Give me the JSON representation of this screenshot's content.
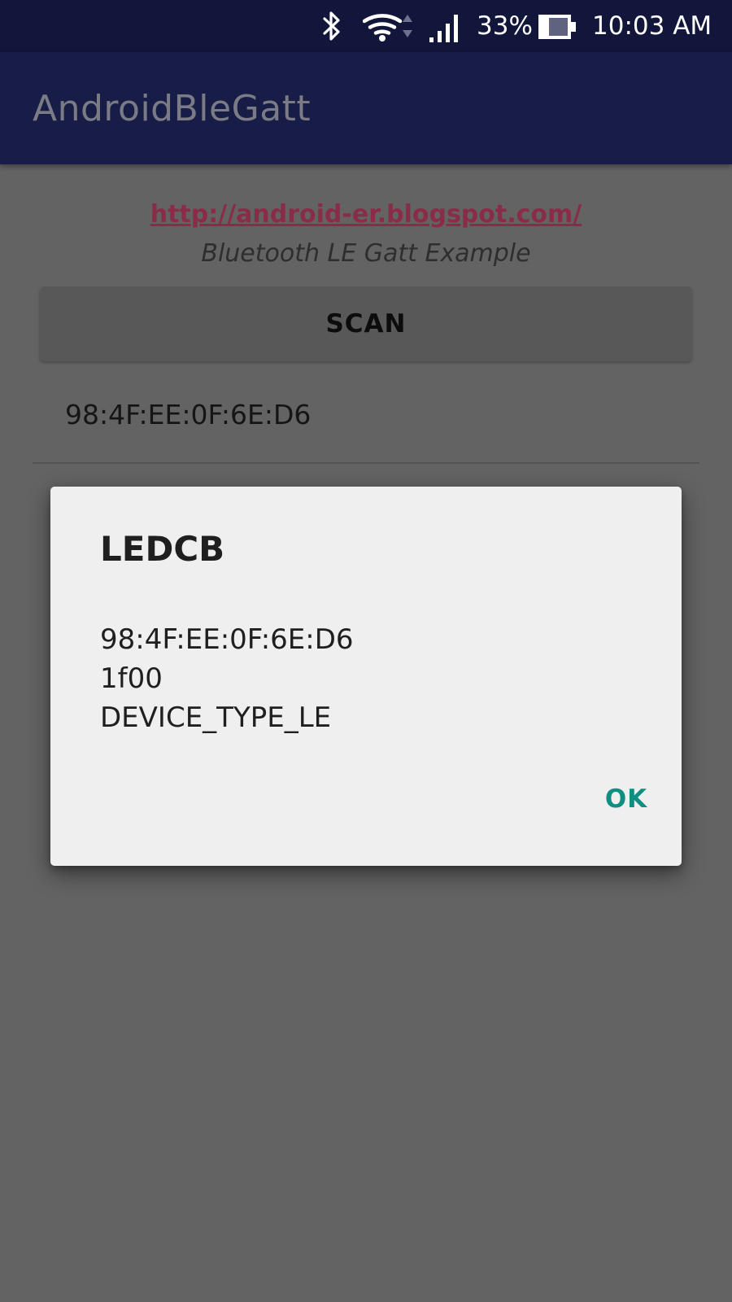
{
  "status_bar": {
    "battery_percent": "33%",
    "time": "10:03 AM",
    "icons": [
      "bluetooth-icon",
      "wifi-icon",
      "signal-icon",
      "battery-icon"
    ]
  },
  "app_bar": {
    "title": "AndroidBleGatt"
  },
  "content": {
    "link": "http://android-er.blogspot.com/",
    "subtitle": "Bluetooth LE Gatt Example",
    "scan_label": "SCAN",
    "devices": [
      {
        "address": "98:4F:EE:0F:6E:D6"
      }
    ]
  },
  "dialog": {
    "title": "LEDCB",
    "lines": [
      "98:4F:EE:0F:6E:D6",
      "1f00",
      "DEVICE_TYPE_LE"
    ],
    "ok_label": "OK"
  },
  "colors": {
    "status_bar": "#12163a",
    "app_bar": "#171d47",
    "scrim_background": "#636363",
    "dialog_background": "#efefef",
    "link": "#8a2c48",
    "accent": "#0f8f82"
  }
}
